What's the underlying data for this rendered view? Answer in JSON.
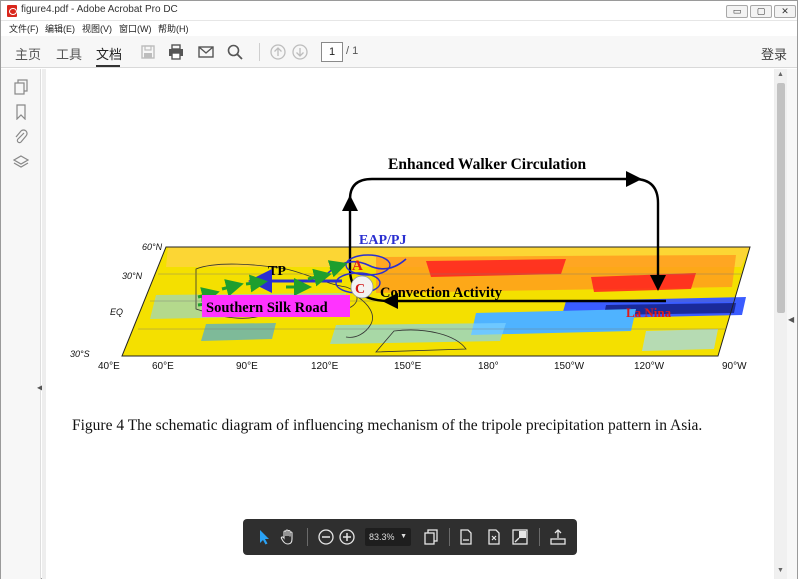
{
  "window": {
    "title": "figure4.pdf - Adobe Acrobat Pro DC",
    "min_label": "▭",
    "restore_label": "▢",
    "close_label": "✕"
  },
  "menubar": [
    "文件(F)",
    "编辑(E)",
    "视图(V)",
    "窗口(W)",
    "帮助(H)"
  ],
  "toolbar": {
    "tabs": [
      "主页",
      "工具",
      "文档"
    ],
    "active_tab": "文档",
    "page_current": "1",
    "page_total": "/ 1",
    "login_label": "登录"
  },
  "figure": {
    "title_walker": "Enhanced  Walker Circulation",
    "eap_pj": "EAP/PJ",
    "tp": "TP",
    "southern_silk_road": "Southern Silk Road",
    "convection": "Convection Activity",
    "la_nina": "La Nina",
    "anticyclone_letter": "A",
    "cyclone_letter": "C",
    "lat_labels": [
      "60°N",
      "30°N",
      "EQ",
      "30°S"
    ],
    "lon_labels": [
      "40°E",
      "60°E",
      "90°E",
      "120°E",
      "150°E",
      "180°",
      "150°W",
      "120°W",
      "90°W"
    ],
    "caption": "Figure 4 The schematic diagram of influencing mechanism of the tripole precipitation pattern in Asia."
  },
  "floatbar": {
    "zoom": "83.3%"
  },
  "colors": {
    "accent_blue": "#2a2fd0",
    "arrow_green": "#1e9e2e",
    "label_red": "#e01a1a",
    "magenta_box": "#ff33ff"
  }
}
